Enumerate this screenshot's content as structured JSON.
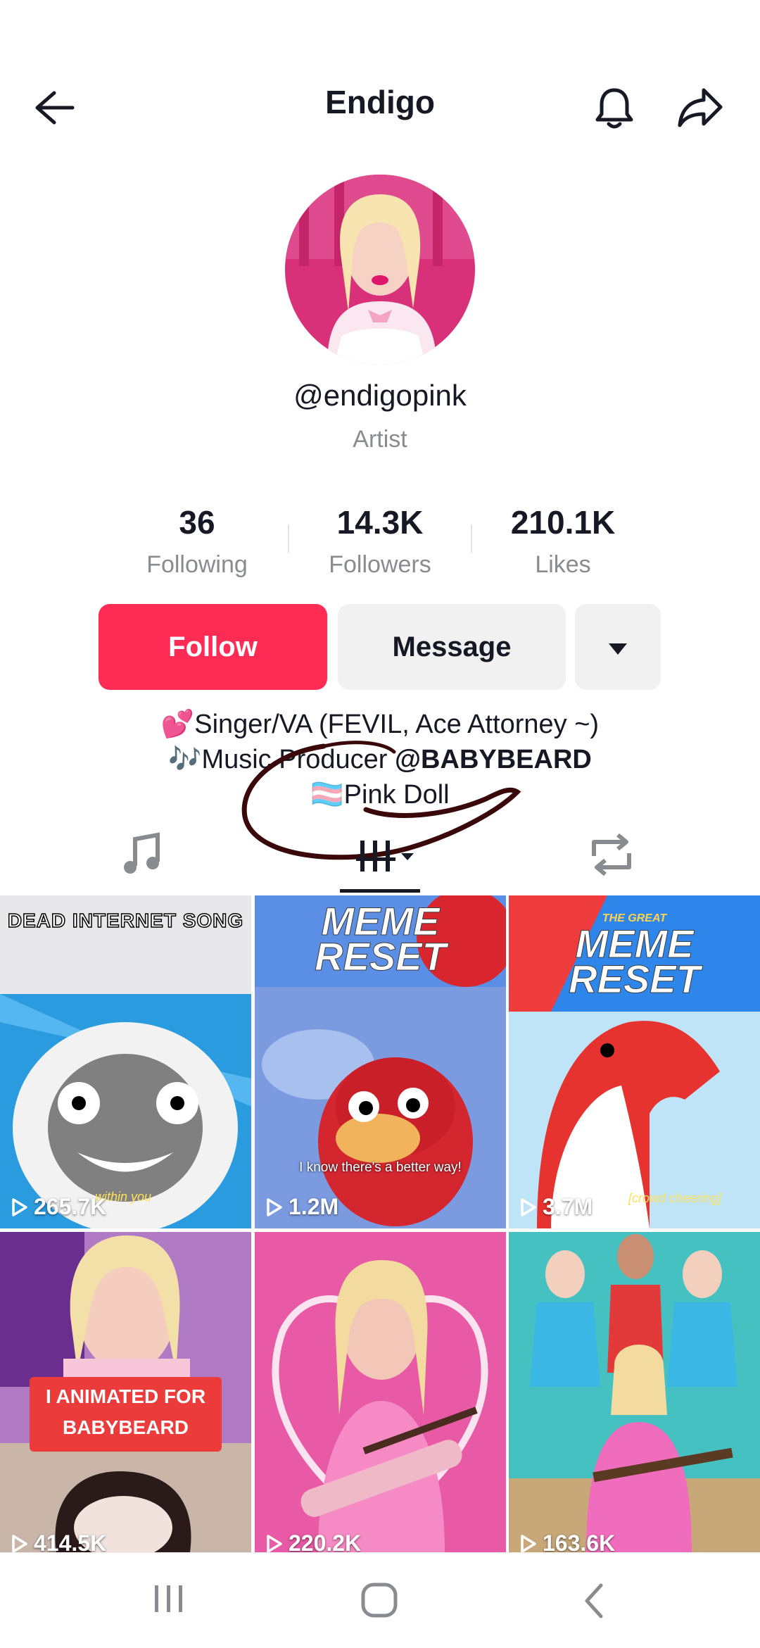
{
  "header": {
    "title": "Endigo"
  },
  "profile": {
    "handle": "@endigopink",
    "role": "Artist"
  },
  "stats": [
    {
      "value": "36",
      "label": "Following"
    },
    {
      "value": "14.3K",
      "label": "Followers"
    },
    {
      "value": "210.1K",
      "label": "Likes"
    }
  ],
  "actions": {
    "follow": "Follow",
    "message": "Message"
  },
  "bio": {
    "line1": "💕Singer/VA (FEVIL, Ace Attorney ~)",
    "line2_prefix": "🎶Music Producer ",
    "line2_mention": "@BABYBEARD",
    "line3": "🏳️‍⚧️Pink Doll"
  },
  "videos": [
    {
      "views": "265.7K",
      "title_text": "DEAD INTERNET SONG",
      "caption": "within you"
    },
    {
      "views": "1.2M",
      "title_text": "MEME RESET",
      "caption": "I know there's a better way!"
    },
    {
      "views": "3.7M",
      "title_text": "MEME RESET",
      "super": "THE GREAT",
      "caption": "[crowd cheering]"
    },
    {
      "views": "414.5K",
      "overlay1": "I ANIMATED FOR",
      "overlay2": "BABYBEARD"
    },
    {
      "views": "220.2K"
    },
    {
      "views": "163.6K"
    }
  ],
  "colors": {
    "accent": "#fe2c55",
    "secondary_btn": "#f1f1f2",
    "muted_text": "#8a8b91"
  }
}
